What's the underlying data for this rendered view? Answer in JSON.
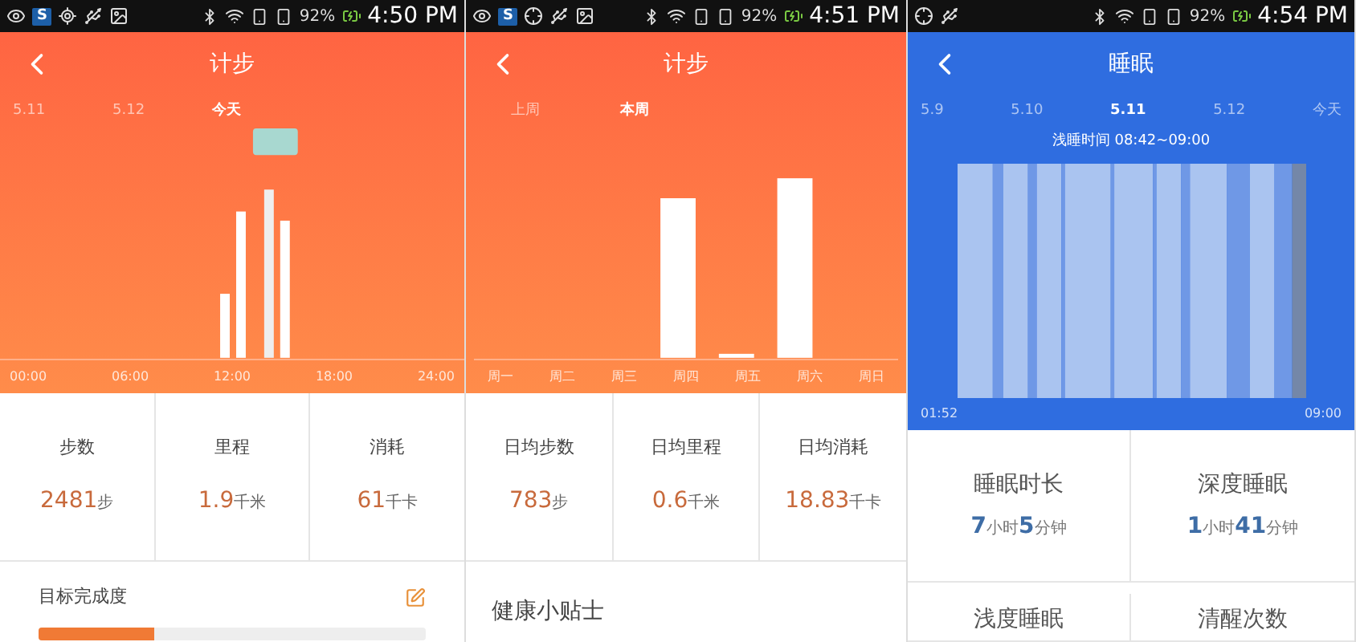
{
  "panels": [
    {
      "kind": "steps_day",
      "status": {
        "app_badge": "S",
        "battery": "92%",
        "time": "4:50 PM"
      },
      "title": "计步",
      "periods": [
        {
          "label": "5.11",
          "selected": false
        },
        {
          "label": "5.12",
          "selected": false
        },
        {
          "label": "今天",
          "selected": true
        }
      ],
      "axis": [
        "00:00",
        "06:00",
        "12:00",
        "18:00",
        "24:00"
      ],
      "stats": [
        {
          "label": "步数",
          "value": "2481",
          "unit": "步"
        },
        {
          "label": "里程",
          "value": "1.9",
          "unit": "千米"
        },
        {
          "label": "消耗",
          "value": "61",
          "unit": "千卡"
        }
      ],
      "goal": {
        "title": "目标完成度",
        "level": 0.3
      }
    },
    {
      "kind": "steps_week",
      "status": {
        "app_badge": "S",
        "battery": "92%",
        "time": "4:51 PM"
      },
      "title": "计步",
      "periods": [
        {
          "label": "上周",
          "selected": false
        },
        {
          "label": "本周",
          "selected": true
        }
      ],
      "axis": [
        "周一",
        "周二",
        "周三",
        "周四",
        "周五",
        "周六",
        "周日"
      ],
      "stats": [
        {
          "label": "日均步数",
          "value": "783",
          "unit": "步"
        },
        {
          "label": "日均里程",
          "value": "0.6",
          "unit": "千米"
        },
        {
          "label": "日均消耗",
          "value": "18.83",
          "unit": "千卡"
        }
      ],
      "tips": {
        "title": "健康小贴士"
      }
    },
    {
      "kind": "sleep",
      "status": {
        "battery": "92%",
        "time": "4:54 PM"
      },
      "title": "睡眠",
      "periods": [
        {
          "label": "5.9",
          "selected": false
        },
        {
          "label": "5.10",
          "selected": false
        },
        {
          "label": "5.11",
          "selected": true
        },
        {
          "label": "5.12",
          "selected": false
        },
        {
          "label": "今天",
          "selected": false
        }
      ],
      "subtitle": "浅睡时间  08:42~09:00",
      "axis": [
        "01:52",
        "09:00"
      ],
      "stats": [
        {
          "label": "睡眠时长",
          "parts": [
            {
              "text": "7",
              "kind": "number"
            },
            {
              "text": "小时",
              "kind": "unit"
            },
            {
              "text": "5",
              "kind": "number"
            },
            {
              "text": "分钟",
              "kind": "unit"
            }
          ]
        },
        {
          "label": "深度睡眠",
          "parts": [
            {
              "text": "1",
              "kind": "number"
            },
            {
              "text": "小时",
              "kind": "unit"
            },
            {
              "text": "41",
              "kind": "number"
            },
            {
              "text": "分钟",
              "kind": "unit"
            }
          ]
        },
        {
          "label": "浅度睡眠"
        },
        {
          "label": "清醒次数"
        }
      ]
    }
  ]
}
